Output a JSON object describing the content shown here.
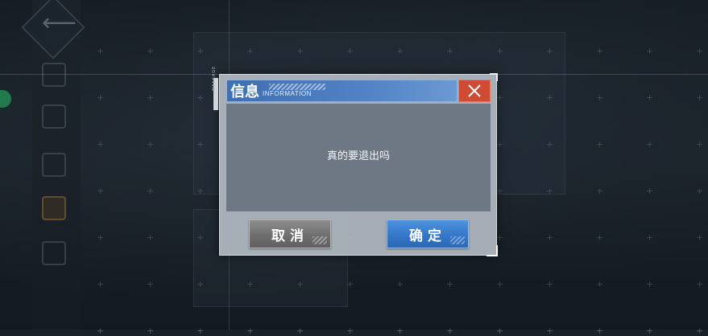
{
  "dialog": {
    "title": "信息",
    "subtitle": "INFORMATION",
    "side_tag": "MESSAGE",
    "message": "真的要退出吗",
    "cancel_label": "取消",
    "confirm_label": "确定"
  },
  "icons": {
    "close": "close-icon",
    "back": "back-arrow-icon"
  },
  "colors": {
    "title_bar": "#4a7ac0",
    "close_button": "#cf4b33",
    "confirm_button": "#3577c8",
    "cancel_button": "#7a7a7a",
    "status_dot": "#2fb36a"
  }
}
